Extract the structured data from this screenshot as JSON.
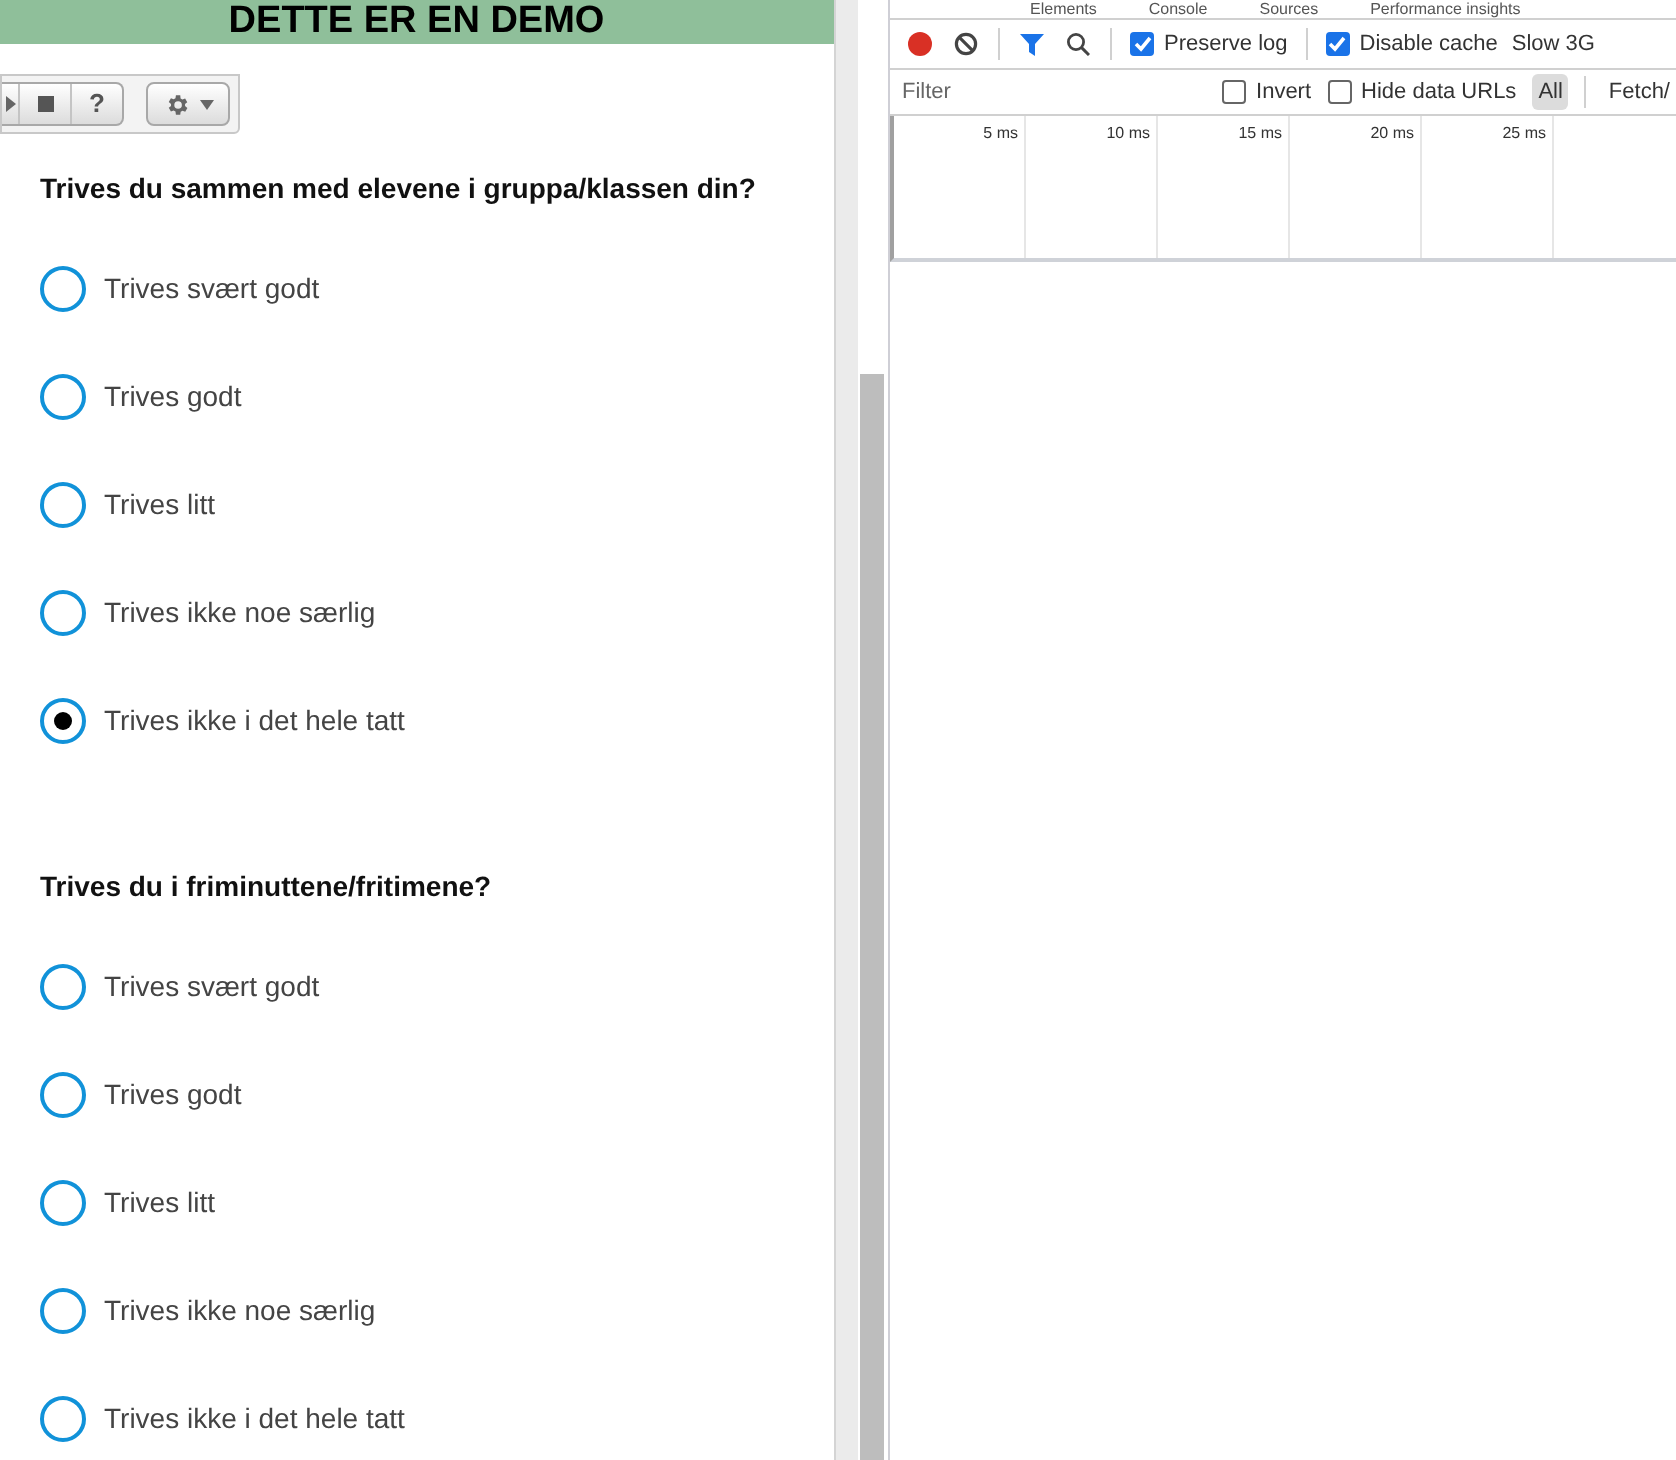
{
  "banner": {
    "title": "DETTE ER EN DEMO"
  },
  "player_toolbar": {
    "buttons": [
      {
        "kind": "play"
      },
      {
        "kind": "stop"
      },
      {
        "kind": "help",
        "label": "?"
      }
    ],
    "settings": {
      "kind": "gear"
    }
  },
  "questions": [
    {
      "text": "Trives du sammen med elevene i gruppa/klassen din?",
      "options": [
        {
          "label": "Trives svært godt",
          "selected": false
        },
        {
          "label": "Trives godt",
          "selected": false
        },
        {
          "label": "Trives litt",
          "selected": false
        },
        {
          "label": "Trives ikke noe særlig",
          "selected": false
        },
        {
          "label": "Trives ikke i det hele tatt",
          "selected": true
        }
      ]
    },
    {
      "text": "Trives du i friminuttene/fritimene?",
      "options": [
        {
          "label": "Trives svært godt",
          "selected": false
        },
        {
          "label": "Trives godt",
          "selected": false
        },
        {
          "label": "Trives litt",
          "selected": false
        },
        {
          "label": "Trives ikke noe særlig",
          "selected": false
        },
        {
          "label": "Trives ikke i det hele tatt",
          "selected": false
        }
      ]
    }
  ],
  "devtools": {
    "tabs": [
      "Elements",
      "Console",
      "Sources",
      "Performance insights"
    ],
    "toolbar": {
      "preserve_log": {
        "label": "Preserve log",
        "checked": true
      },
      "disable_cache": {
        "label": "Disable cache",
        "checked": true
      },
      "throttling": "Slow 3G"
    },
    "filter_bar": {
      "placeholder": "Filter",
      "invert": {
        "label": "Invert",
        "checked": false
      },
      "hide_data_urls": {
        "label": "Hide data URLs",
        "checked": false
      },
      "types": [
        {
          "label": "All",
          "selected": true
        },
        {
          "label": "Fetch/",
          "selected": false
        }
      ]
    },
    "timeline_ticks": [
      "5 ms",
      "10 ms",
      "15 ms",
      "20 ms",
      "25 ms"
    ]
  }
}
